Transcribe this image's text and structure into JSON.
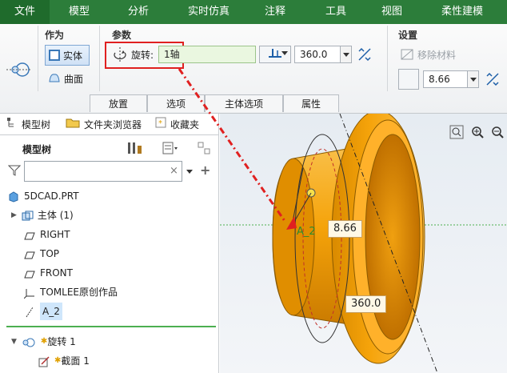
{
  "menu": {
    "items": [
      "文件",
      "模型",
      "分析",
      "实时仿真",
      "注释",
      "工具",
      "视图",
      "柔性建模"
    ]
  },
  "ribbon": {
    "group_zuowei": "作为",
    "group_canshu": "参数",
    "group_shezhi": "设置",
    "solid_label": "实体",
    "surface_label": "曲面",
    "rotate_label": "旋转:",
    "axis_value": "1轴",
    "angle_value": "360.0",
    "remove_material_label": "移除材料",
    "thickness_value": "8.66",
    "tabs": [
      "放置",
      "选项",
      "主体选项",
      "属性"
    ]
  },
  "left_panel": {
    "tab_model_tree": "模型树",
    "tab_folder": "文件夹浏览器",
    "tab_favorites": "收藏夹",
    "tree_title": "模型树",
    "search_placeholder": "",
    "tree_items": [
      "5DCAD.PRT",
      "主体 (1)",
      "RIGHT",
      "TOP",
      "FRONT",
      "TOMLEE原创作品",
      "A_2"
    ],
    "feature_items": [
      "旋转 1",
      "截面 1"
    ]
  },
  "viewport": {
    "dim_thickness": "8.66",
    "dim_angle": "360.0",
    "axis_label": "A_2"
  },
  "colors": {
    "menubar": "#2c7d3a",
    "part_orange": "#f5a30a",
    "highlight_red": "#e02020"
  }
}
